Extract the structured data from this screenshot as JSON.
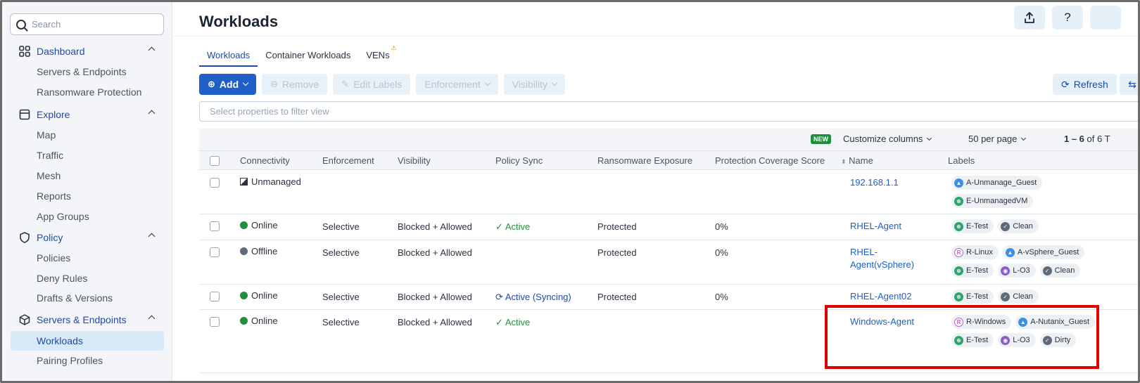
{
  "sidebar": {
    "search_placeholder": "Search",
    "sections": {
      "dashboard": "Dashboard",
      "explore": "Explore",
      "policy": "Policy",
      "servers": "Servers & Endpoints"
    },
    "items": {
      "servers_endpoints": "Servers & Endpoints",
      "ransomware": "Ransomware Protection",
      "map": "Map",
      "traffic": "Traffic",
      "mesh": "Mesh",
      "reports": "Reports",
      "app_groups": "App Groups",
      "policies": "Policies",
      "deny_rules": "Deny Rules",
      "drafts": "Drafts & Versions",
      "workloads": "Workloads",
      "pairing": "Pairing Profiles"
    }
  },
  "header": {
    "title": "Workloads",
    "export_icon": "export-icon",
    "help_label": "?"
  },
  "tabs": [
    "Workloads",
    "Container Workloads",
    "VENs"
  ],
  "toolbar": {
    "add": "Add",
    "remove": "Remove",
    "edit_labels": "Edit Labels",
    "enforcement": "Enforcement",
    "visibility": "Visibility",
    "refresh": "Refresh"
  },
  "filter_placeholder": "Select properties to filter view",
  "grid": {
    "new_badge": "NEW",
    "customize": "Customize columns",
    "per_page": "50 per page",
    "range_bold": "1 – 6",
    "range_rest": " of 6 T"
  },
  "columns": {
    "connectivity": "Connectivity",
    "enforcement": "Enforcement",
    "visibility": "Visibility",
    "policy_sync": "Policy Sync",
    "ransomware": "Ransomware Exposure",
    "coverage": "Protection Coverage Score",
    "name": "Name",
    "labels": "Labels"
  },
  "rows": [
    {
      "connectivity": "Unmanaged",
      "enforcement": "",
      "visibility": "",
      "policy_sync": "",
      "ransomware": "",
      "coverage": "",
      "name": "192.168.1.1",
      "name2": "",
      "labels": [
        [
          "A",
          "A-Unmanage_Guest"
        ],
        [
          "E",
          "E-UnmanagedVM"
        ]
      ]
    },
    {
      "connectivity": "Online",
      "enforcement": "Selective",
      "visibility": "Blocked + Allowed",
      "policy_sync": "Active",
      "ransomware": "Protected",
      "coverage": "0%",
      "name": "RHEL-Agent",
      "name2": "",
      "labels": [
        [
          "E",
          "E-Test"
        ],
        [
          "C",
          "Clean"
        ]
      ]
    },
    {
      "connectivity": "Offline",
      "enforcement": "Selective",
      "visibility": "Blocked + Allowed",
      "policy_sync": "",
      "ransomware": "Protected",
      "coverage": "0%",
      "name": "RHEL-",
      "name2": "Agent(vSphere)",
      "labels": [
        [
          "R",
          "R-Linux"
        ],
        [
          "A",
          "A-vSphere_Guest"
        ],
        [
          "E",
          "E-Test"
        ],
        [
          "L",
          "L-O3"
        ],
        [
          "C",
          "Clean"
        ]
      ]
    },
    {
      "connectivity": "Online",
      "enforcement": "Selective",
      "visibility": "Blocked + Allowed",
      "policy_sync": "Active (Syncing)",
      "ransomware": "Protected",
      "coverage": "0%",
      "name": "RHEL-Agent02",
      "name2": "",
      "labels": [
        [
          "E",
          "E-Test"
        ],
        [
          "C",
          "Clean"
        ]
      ]
    },
    {
      "connectivity": "Online",
      "enforcement": "Selective",
      "visibility": "Blocked + Allowed",
      "policy_sync": "Active",
      "ransomware": "",
      "coverage": "",
      "name": "Windows-Agent",
      "name2": "",
      "labels": [
        [
          "R",
          "R-Windows"
        ],
        [
          "A",
          "A-Nutanix_Guest"
        ],
        [
          "E",
          "E-Test"
        ],
        [
          "L",
          "L-O3"
        ],
        [
          "C",
          "Dirty"
        ]
      ]
    }
  ],
  "colors": {
    "primary": "#1f5fc7",
    "online": "#1f8f3d",
    "offline": "#5f6b7a",
    "highlight": "#e00000"
  }
}
